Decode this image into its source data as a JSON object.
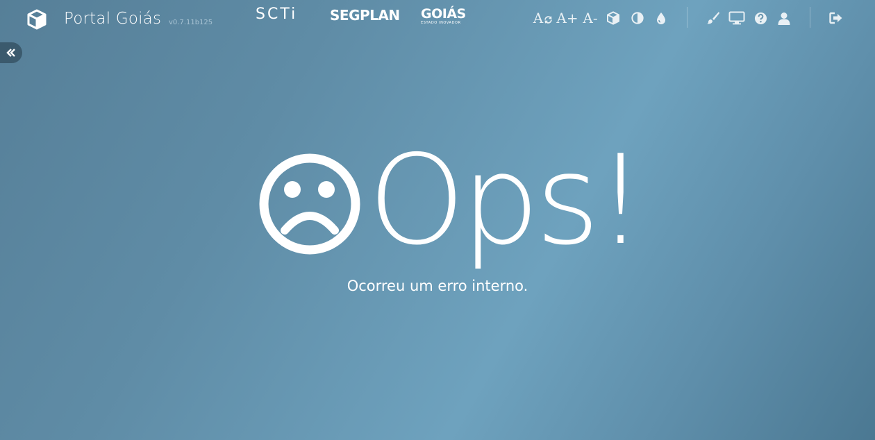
{
  "header": {
    "app_name": "Portal Goiás",
    "version": "v0.7.11b125",
    "logos": {
      "scti": "SCTi",
      "segplan": "SEGPLAN",
      "goias": "GOIÁS",
      "goias_tagline": "ESTADO INOVADOR"
    },
    "accessibility_tools": [
      {
        "name": "font-reset",
        "label": "A",
        "icon": "refresh-icon"
      },
      {
        "name": "font-increase",
        "label": "A+"
      },
      {
        "name": "font-decrease",
        "label": "A-"
      },
      {
        "name": "3d",
        "icon": "cube-icon"
      },
      {
        "name": "contrast",
        "icon": "contrast-icon"
      },
      {
        "name": "color",
        "icon": "drop-icon"
      }
    ],
    "user_tools": [
      {
        "name": "theme",
        "icon": "brush-icon"
      },
      {
        "name": "display",
        "icon": "monitor-icon"
      },
      {
        "name": "help",
        "icon": "question-icon"
      },
      {
        "name": "user",
        "icon": "user-icon"
      }
    ],
    "logout_icon": "sign-out-icon"
  },
  "sidebar": {
    "toggle_icon": "double-chevron-left-icon"
  },
  "error": {
    "title": "Ops!",
    "message": "Ocorreu um erro interno.",
    "face_icon": "sad-face-icon"
  },
  "colors": {
    "background_start": "#567f98",
    "background_mid": "#6ea2be",
    "background_end": "#4b7892",
    "toggle_bg": "#3b5a6d"
  }
}
